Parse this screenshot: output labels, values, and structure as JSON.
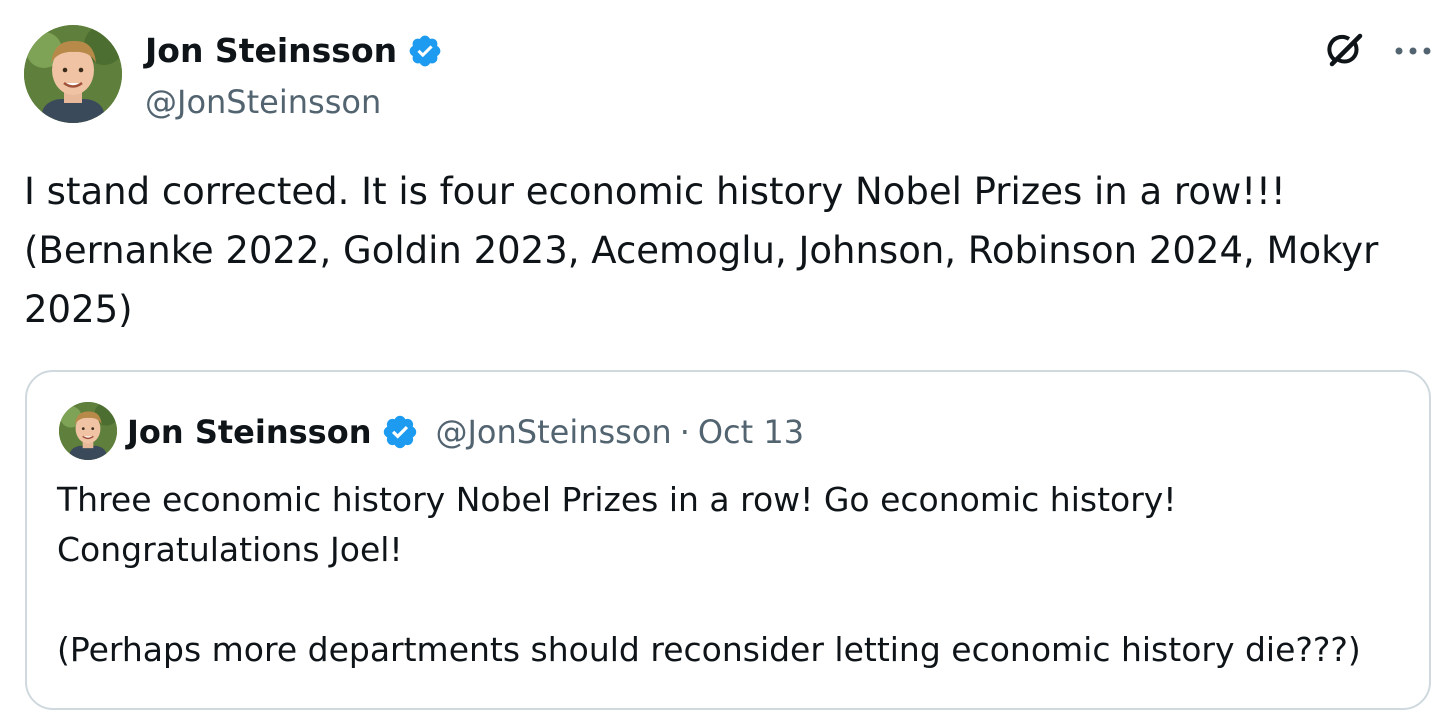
{
  "tweet": {
    "author": {
      "name": "Jon Steinsson",
      "handle": "@JonSteinsson",
      "verified": true
    },
    "text": "I stand corrected. It is four economic history Nobel Prizes in a row!!!\n(Bernanke 2022, Goldin 2023, Acemoglu, Johnson, Robinson 2024, Mokyr\n2025)",
    "icons": {
      "grok": "grok-icon",
      "more": "more-options-icon",
      "verified": "verified-badge-icon"
    }
  },
  "quoted_tweet": {
    "author": {
      "name": "Jon Steinsson",
      "handle": "@JonSteinsson",
      "verified": true
    },
    "separator": "·",
    "date": "Oct 13",
    "text": "Three economic history Nobel Prizes in a row! Go economic history!\nCongratulations Joel!\n\n(Perhaps more departments should reconsider letting economic history die???)"
  },
  "colors": {
    "verified_blue": "#1d9bf0",
    "text_primary": "#0f1419",
    "text_secondary": "#536471",
    "border": "#cfd9de"
  }
}
